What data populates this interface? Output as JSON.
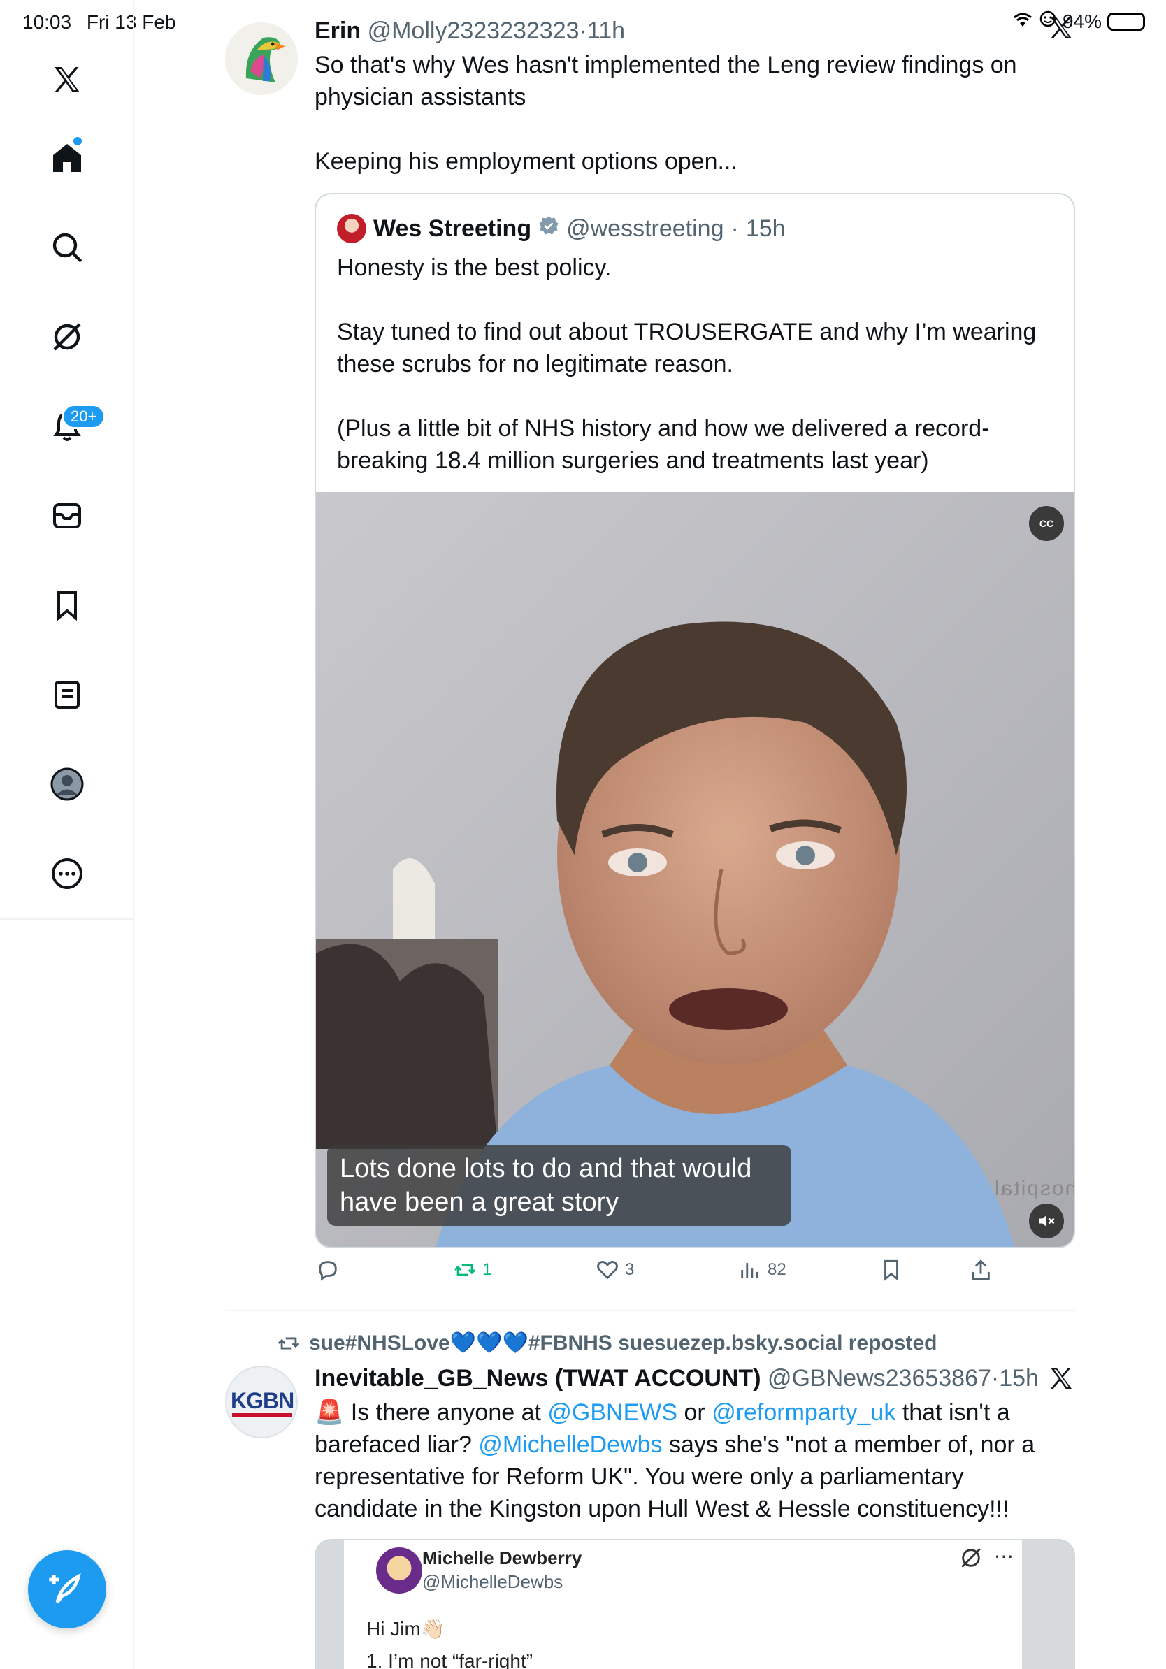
{
  "status_bar": {
    "time": "10:03",
    "date": "Fri 13 Feb",
    "battery": "94%"
  },
  "sidebar": {
    "notifications_badge": "20+",
    "items": [
      "x-logo",
      "home",
      "search",
      "grok",
      "notifications",
      "messages",
      "bookmarks",
      "lists",
      "profile",
      "more"
    ]
  },
  "tweet1": {
    "name": "Erin",
    "handle": "@Molly2323232323",
    "dot": "·",
    "time": "11h",
    "body": [
      "So that's why Wes hasn't implemented the Leng review findings on physician assistants",
      "",
      "Keeping his employment options open..."
    ],
    "quote": {
      "name": "Wes Streeting",
      "handle": "@wesstreeting",
      "dot": "·",
      "time": "15h",
      "body": [
        "Honesty is the best policy.",
        "",
        "Stay tuned to find out about TROUSERGATE and why I’m wearing these scrubs for no legitimate reason.",
        "",
        "(Plus a little bit of NHS history and how we delivered a record-breaking 18.4 million surgeries and treatments last year)"
      ],
      "video": {
        "cc_label": "CC",
        "caption": "Lots done lots to do and that would have been a great story",
        "wall_text": "hospital"
      }
    },
    "actions": {
      "replies": "",
      "reposts": "1",
      "likes": "3",
      "views": "82"
    }
  },
  "tweet2": {
    "repost_by": "sue#NHSLove💙💙💙#FBNHS suesuezep.bsky.social reposted",
    "name": "Inevitable_GB_News (TWAT ACCOUNT)",
    "handle": "@GBNews23653867",
    "dot": "·",
    "time": "15h",
    "avatar_text": "KGBN",
    "body_parts": {
      "p1": "🚨 Is there anyone at ",
      "m1": "@GBNEWS",
      "p2": " or ",
      "m2": "@reformparty_uk",
      "p3": " that isn't a barefaced liar? ",
      "m3": "@MichelleDewbs",
      "p4": " says she's \"not a member of, nor a representative for Reform UK\". You were only a parliamentary candidate in the Kingston upon Hull West & Hessle constituency!!!"
    },
    "image": {
      "name": "Michelle Dewberry",
      "handle": "@MichelleDewbs",
      "line1": "Hi Jim👋🏻",
      "line2": "1. I’m not “far-right”"
    }
  },
  "colors": {
    "accent": "#1d9bf0",
    "repost_green": "#00ba7c",
    "muted": "#536471"
  },
  "icons": {
    "more": "more-icon",
    "close": "x-logo-icon"
  }
}
